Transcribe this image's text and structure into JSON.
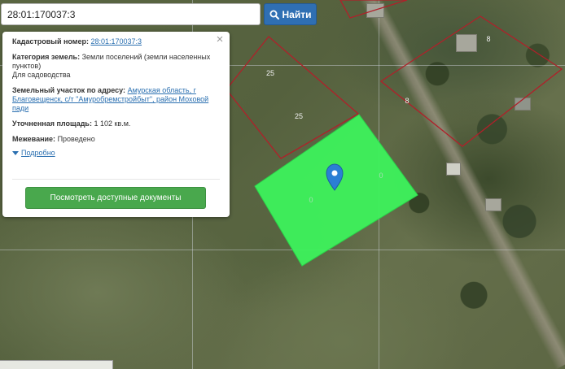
{
  "search": {
    "value": "28:01:170037:3",
    "button_label": "Найти"
  },
  "popup": {
    "cadastral_label": "Кадастровый номер:",
    "cadastral_value": "28:01:170037:3",
    "category_label": "Категория земель:",
    "category_value": "Земли поселений (земли населенных пунктов)",
    "category_use": "Для садоводства",
    "address_label": "Земельный участок по адресу:",
    "address_value": "Амурская область, г Благовещенск, с/т \"Амуробремстройбыт\", район Моховой пади",
    "area_label": "Уточненная площадь:",
    "area_value": "1 102 кв.м.",
    "survey_label": "Межевание:",
    "survey_value": "Проведено",
    "details_link": "Подробно",
    "docs_button": "Посмотреть доступные документы"
  },
  "map": {
    "parcel_labels": [
      "25",
      "25",
      "8",
      "8",
      "0",
      "0"
    ],
    "colors": {
      "selected_parcel": "#3df25c",
      "parcel_outline": "#b0202a",
      "marker": "#2b7fd4"
    }
  }
}
